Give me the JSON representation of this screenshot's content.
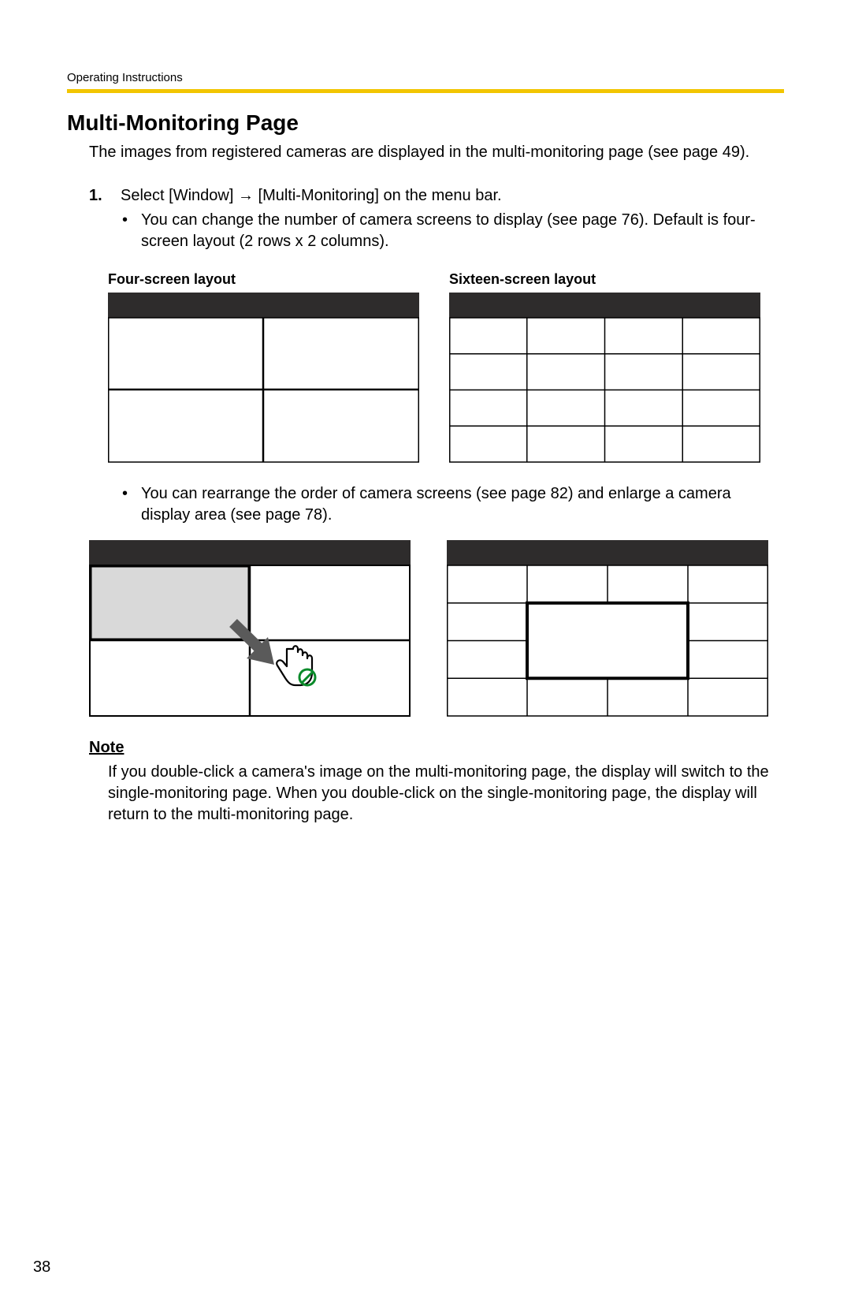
{
  "header": {
    "running_head": "Operating Instructions"
  },
  "title": "Multi-Monitoring Page",
  "intro": "The images from registered cameras are displayed in the multi-monitoring page (see page 49).",
  "step": {
    "number": "1.",
    "text_before": "Select [Window] ",
    "text_after": " [Multi-Monitoring] on the menu bar."
  },
  "bullet1": "You can change the number of camera screens to display (see page 76). Default is four-screen layout (2 rows x 2 columns).",
  "layouts": {
    "four_caption": "Four-screen layout",
    "sixteen_caption": "Sixteen-screen layout"
  },
  "bullet2": "You can rearrange the order of camera screens (see page 82) and enlarge a camera display area (see page 78).",
  "note": {
    "heading": "Note",
    "body": "If you double-click a camera's image on the multi-monitoring page, the display will switch to the single-monitoring page. When you double-click on the single-monitoring page, the display will return to the multi-monitoring page."
  },
  "page_number": "38"
}
